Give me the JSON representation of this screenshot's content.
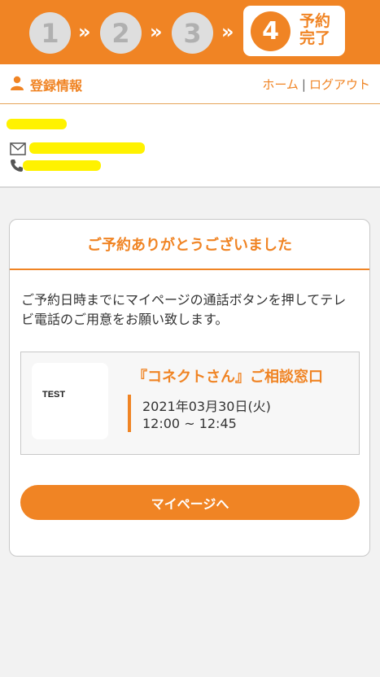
{
  "steps": {
    "items": [
      "1",
      "2",
      "3"
    ],
    "separator": "»",
    "active_number": "4",
    "active_label": "予約完了"
  },
  "header": {
    "section_label": "登録情報",
    "home_link": "ホーム",
    "separator": "|",
    "logout_link": "ログアウト"
  },
  "user": {
    "name": "",
    "email": "",
    "phone": ""
  },
  "card": {
    "title": "ご予約ありがとうございました",
    "message": "ご予約日時までにマイページの通話ボタンを押してテレビ電話のご用意をお願い致します。",
    "appointment": {
      "thumb_text": "TEST",
      "title": "『コネクトさん』ご相談窓口",
      "date": "2021年03月30日(火)",
      "time": "12:00 ~ 12:45"
    },
    "mypage_button": "マイページへ"
  },
  "colors": {
    "accent": "#f08424",
    "background": "#f2f2f2",
    "redaction": "#fff200"
  }
}
